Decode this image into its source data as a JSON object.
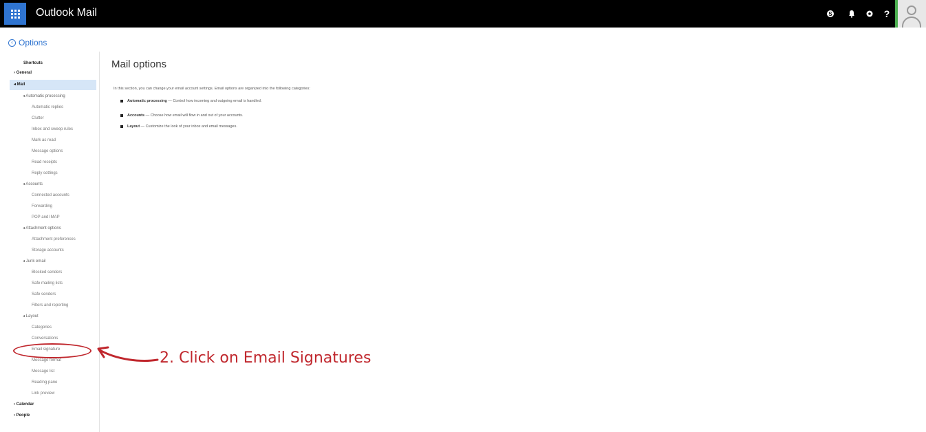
{
  "topbar": {
    "app_title": "Outlook Mail",
    "icons": [
      "skype-icon",
      "bell-icon",
      "gear-icon",
      "help-icon"
    ],
    "help_glyph": "?"
  },
  "options": {
    "label": "Options"
  },
  "nav": {
    "shortcuts": "Shortcuts",
    "general": "› General",
    "mail": "◂ Mail",
    "automatic_processing": "◂ Automatic processing",
    "automatic_replies": "Automatic replies",
    "clutter": "Clutter",
    "inbox_rules": "Inbox and sweep rules",
    "mark_as_read": "Mark as read",
    "message_options": "Message options",
    "read_receipts": "Read receipts",
    "reply_settings": "Reply settings",
    "accounts": "◂ Accounts",
    "connected_accounts": "Connected accounts",
    "forwarding": "Forwarding",
    "pop_imap": "POP and IMAP",
    "attachment_options": "◂ Attachment options",
    "attachment_preferences": "Attachment preferences",
    "storage_accounts": "Storage accounts",
    "junk_email": "◂ Junk email",
    "blocked_senders": "Blocked senders",
    "safe_mailing_lists": "Safe mailing lists",
    "safe_senders": "Safe senders",
    "filters_reporting": "Filters and reporting",
    "layout": "◂ Layout",
    "categories": "Categories",
    "conversations": "Conversations",
    "email_signature": "Email signature",
    "message_format": "Message format",
    "message_list": "Message list",
    "reading_pane": "Reading pane",
    "link_preview": "Link preview",
    "calendar": "› Calendar",
    "people": "› People"
  },
  "main": {
    "title": "Mail options",
    "intro": "In this section, you can change your email account settings. Email options are organized into the following categories:",
    "bullets": [
      {
        "label": "Automatic processing",
        "text": " — Control how incoming and outgoing email is handled."
      },
      {
        "label": "Accounts",
        "text": " — Choose how email will flow in and out of your accounts."
      },
      {
        "label": "Layout",
        "text": " — Customize the look of your inbox and email messages."
      }
    ]
  },
  "annotation": {
    "text": "2. Click on Email Signatures",
    "color": "#c0272d"
  },
  "colors": {
    "topbar": "#000000",
    "accent": "#2f74d0",
    "avatar_border": "#4caf50",
    "selected_bg": "#d6e6f7"
  }
}
